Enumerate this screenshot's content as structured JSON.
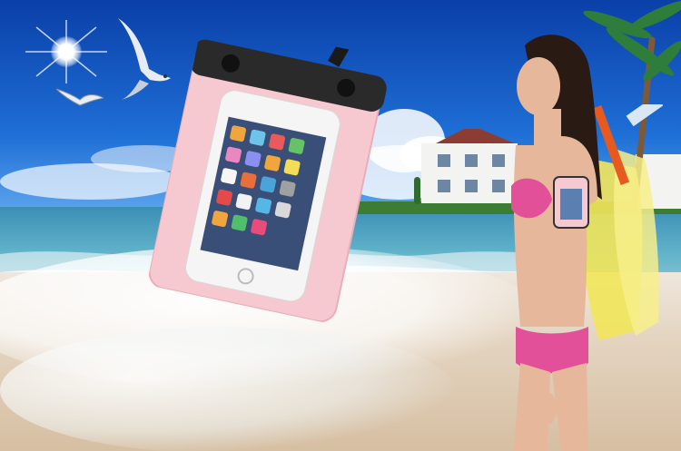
{
  "scene": {
    "description_tags": [
      "sky",
      "sun",
      "seagull-1",
      "seagull-2",
      "sea",
      "beach",
      "white-house",
      "palm-trees",
      "waterproof-phone-pouch",
      "woman-in-bikini",
      "armband-pouch",
      "snorkel-fins"
    ]
  },
  "colors": {
    "sky_top": "#0a3fa8",
    "sea": "#3b8fb5",
    "sand": "#e3d3bf",
    "pouch_pink": "#f6c9d0",
    "pouch_clip": "#2a2a2a",
    "bikini_pink": "#e2509a",
    "fins_yellow": "#f2e65a"
  }
}
